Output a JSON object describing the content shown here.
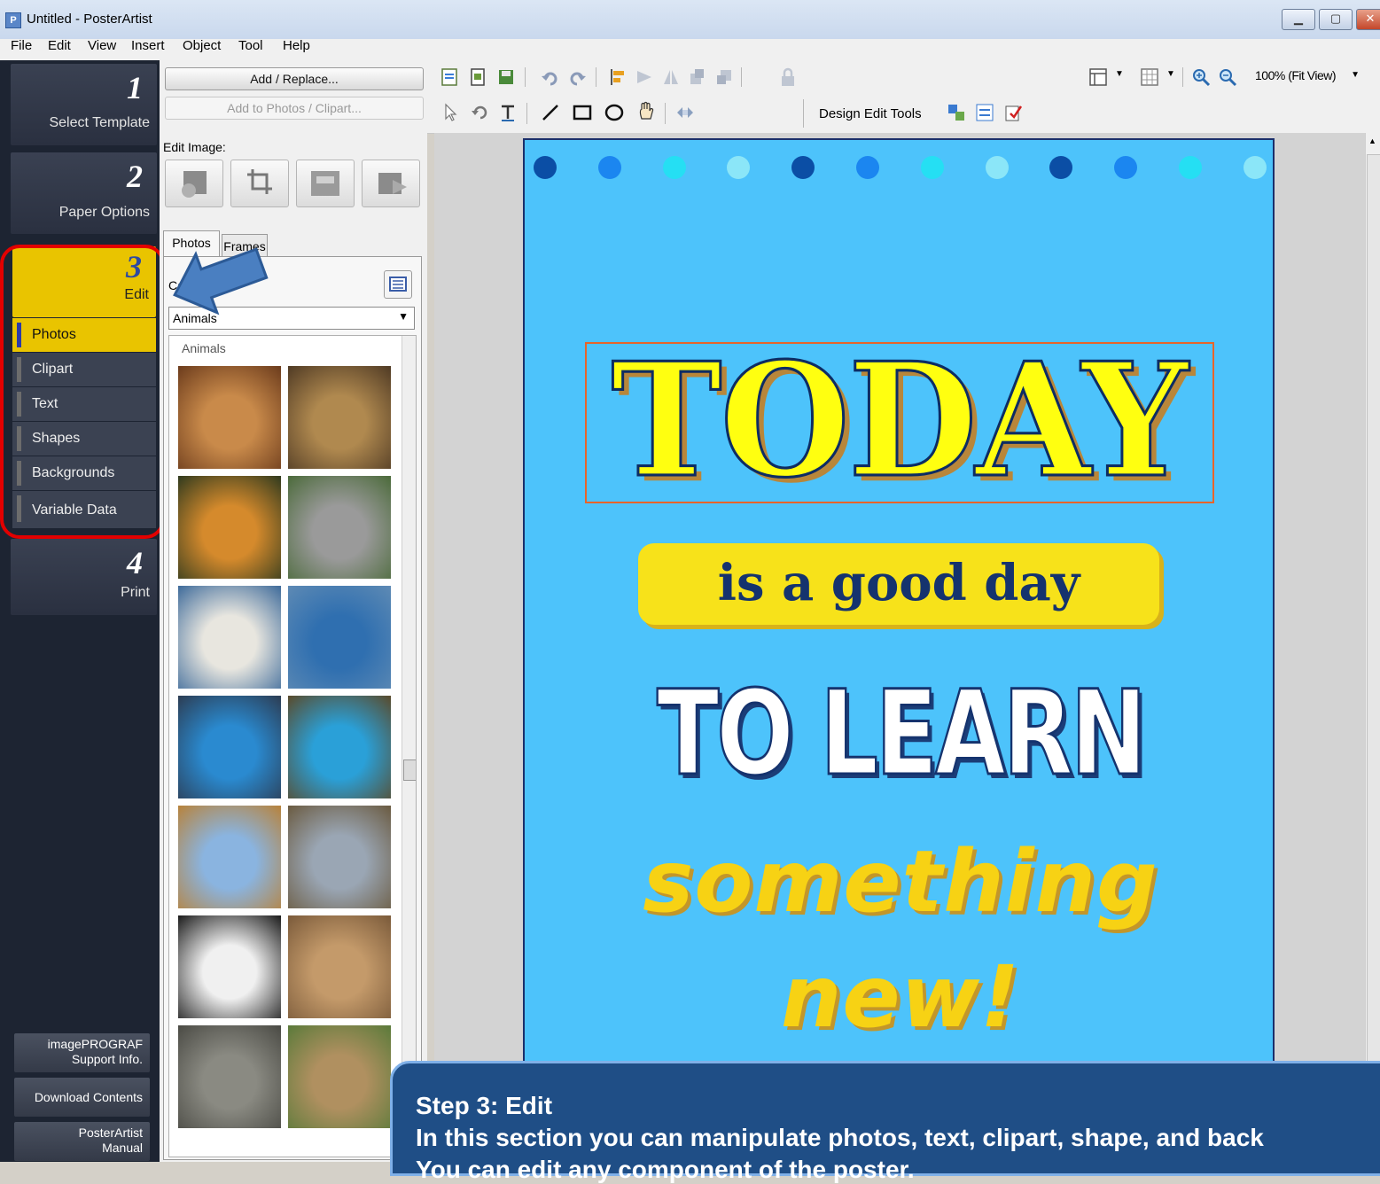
{
  "window": {
    "title": "Untitled - PosterArtist",
    "app_icon": "P"
  },
  "menu": [
    "File",
    "Edit",
    "View",
    "Insert",
    "Object",
    "Tool",
    "Help"
  ],
  "steps": [
    {
      "num": "1",
      "label": "Select Template"
    },
    {
      "num": "2",
      "label": "Paper Options"
    },
    {
      "num": "3",
      "label": "Edit"
    },
    {
      "num": "4",
      "label": "Print"
    }
  ],
  "edit_subitems": [
    "Photos",
    "Clipart",
    "Text",
    "Shapes",
    "Backgrounds",
    "Variable Data"
  ],
  "side_buttons": [
    {
      "line1": "imagePROGRAF",
      "line2": "Support Info."
    },
    {
      "line1": "Download Contents",
      "line2": ""
    },
    {
      "line1": "PosterArtist",
      "line2": "Manual"
    }
  ],
  "panel": {
    "add_replace": "Add / Replace...",
    "add_to_photos": "Add to Photos / Clipart...",
    "edit_image_label": "Edit Image:",
    "tab_photos": "Photos",
    "tab_frames": "Frames",
    "category_label": "Category:",
    "category_value": "Animals",
    "group_label": "Animals"
  },
  "thumbnails": [
    "lioness-photo",
    "cheetah-photo",
    "tiger-photo",
    "koala-photo",
    "polar-bear-photo",
    "dolphin-photo",
    "seal-photo",
    "sea-turtle-photo",
    "giraffe-photo",
    "gerenuk-photo",
    "zebra-photo",
    "camel-photo",
    "elephant-photo",
    "impala-photo"
  ],
  "toolbar": {
    "zoom_value": "100% (Fit View)",
    "design_edit_tools": "Design Edit Tools"
  },
  "poster": {
    "line1": "TODAY",
    "line2": "is a good day",
    "line3": "TO LEARN",
    "line4": "something new!",
    "dot_colors": [
      "#0b4ea5",
      "#1b86f0",
      "#25dff3",
      "#8be6f8",
      "#0b4ea5",
      "#1b86f0",
      "#25dff3",
      "#8be6f8",
      "#0b4ea5",
      "#1b86f0",
      "#25dff3",
      "#8be6f8"
    ]
  },
  "caption": {
    "title": "Step 3: Edit",
    "line1": "In this section you can manipulate photos, text, clipart, shape, and back",
    "line2": "You can edit any component of the poster."
  },
  "colors": {
    "active_step": "#e9c400",
    "poster_bg": "#4dc3fb",
    "highlight_red": "#e30000",
    "arrow_blue": "#4a7fc1"
  }
}
